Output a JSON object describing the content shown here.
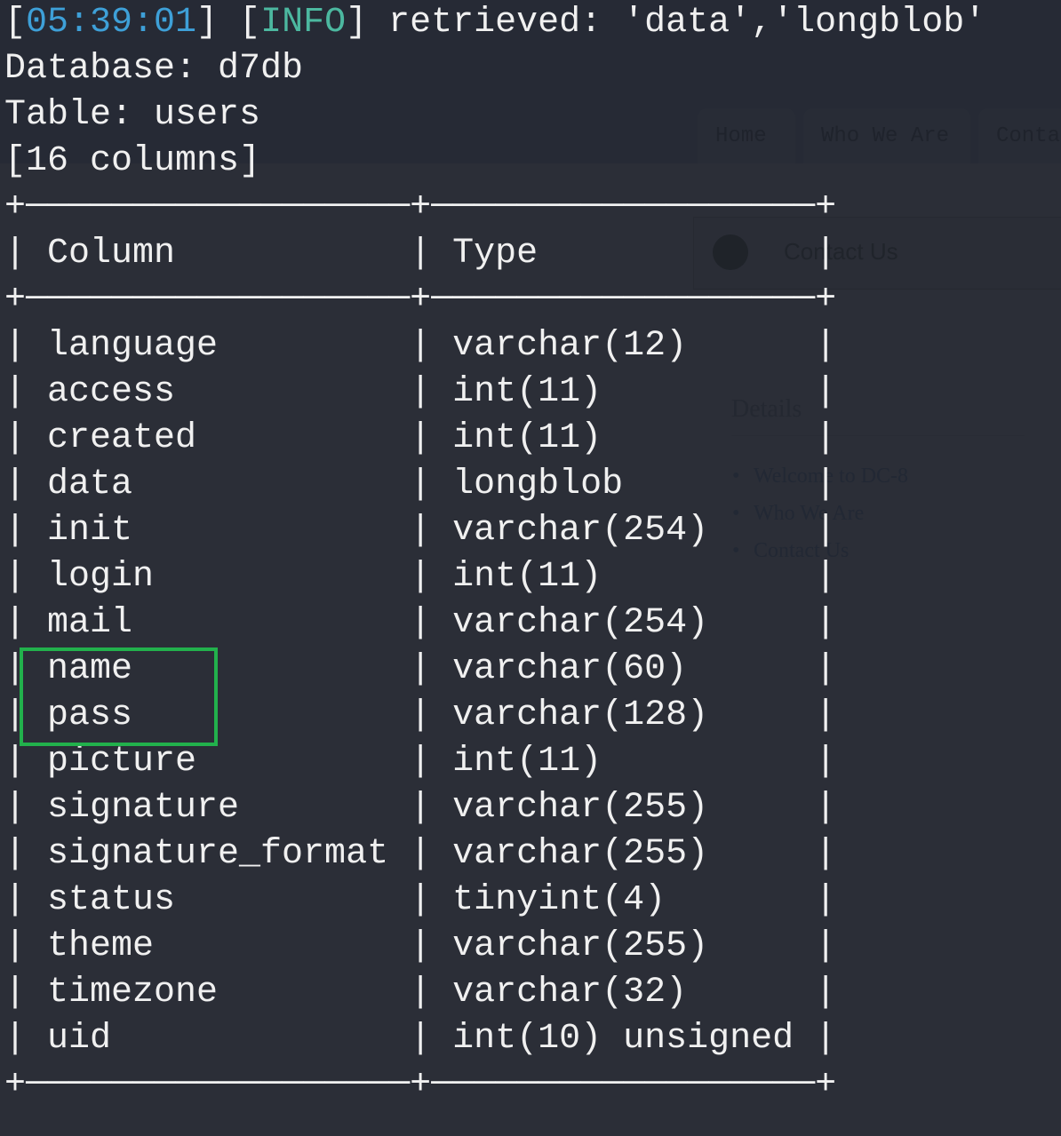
{
  "log": {
    "timestamp": "05:39:01",
    "level": "INFO",
    "message": "retrieved: 'data','longblob'"
  },
  "database_line": "Database: d7db",
  "table_line": "Table: users",
  "count_line": "[16 columns]",
  "table": {
    "headers": [
      "Column",
      "Type"
    ],
    "rows": [
      [
        "language",
        "varchar(12)"
      ],
      [
        "access",
        "int(11)"
      ],
      [
        "created",
        "int(11)"
      ],
      [
        "data",
        "longblob"
      ],
      [
        "init",
        "varchar(254)"
      ],
      [
        "login",
        "int(11)"
      ],
      [
        "mail",
        "varchar(254)"
      ],
      [
        "name",
        "varchar(60)"
      ],
      [
        "pass",
        "varchar(128)"
      ],
      [
        "picture",
        "int(11)"
      ],
      [
        "signature",
        "varchar(255)"
      ],
      [
        "signature_format",
        "varchar(255)"
      ],
      [
        "status",
        "tinyint(4)"
      ],
      [
        "theme",
        "varchar(255)"
      ],
      [
        "timezone",
        "varchar(32)"
      ],
      [
        "uid",
        "int(10) unsigned"
      ]
    ],
    "highlighted_rows": [
      "name",
      "pass"
    ],
    "highlight_color": "#22b14c"
  },
  "background_site": {
    "tabs": [
      "Home",
      "Who We Are",
      "Conta"
    ],
    "card_label": "Contact Us",
    "details_heading": "Details",
    "details_links": [
      "Welcome to DC-8",
      "Who We Are",
      "Contact Us"
    ]
  },
  "colors": {
    "background": "#2b2e37",
    "timestamp": "#3ea0d8",
    "info": "#4cb8a0",
    "text": "#f0f0f0"
  }
}
